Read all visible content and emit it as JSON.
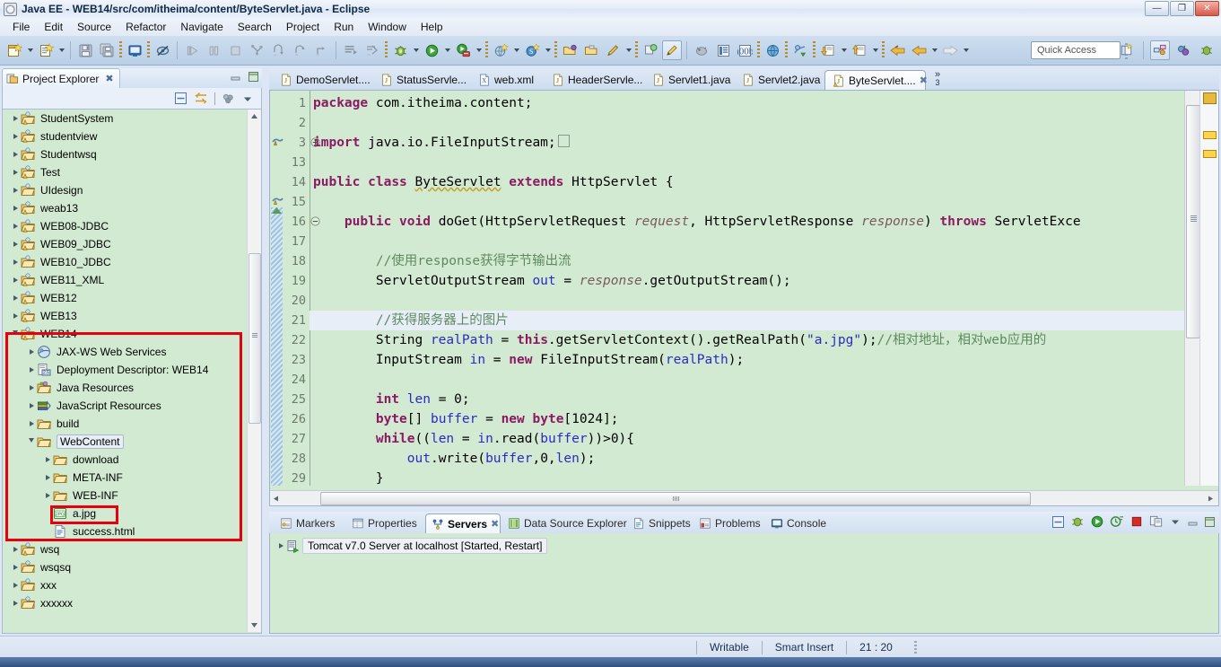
{
  "window": {
    "title": "Java EE - WEB14/src/com/itheima/content/ByteServlet.java - Eclipse",
    "app_icon": "eclipse-icon",
    "minimize_label": "—",
    "maximize_label": "❐",
    "close_label": "✕"
  },
  "menu": {
    "items": [
      "File",
      "Edit",
      "Source",
      "Refactor",
      "Navigate",
      "Search",
      "Project",
      "Run",
      "Window",
      "Help"
    ]
  },
  "toolbar": {
    "quick_access_placeholder": "Quick Access",
    "buttons": [
      {
        "name": "new-wizard-icon",
        "label": ""
      },
      {
        "name": "new-dropdown-arrow",
        "label": ""
      },
      {
        "name": "new-jsp-icon",
        "label": ""
      },
      {
        "name": "new-jsp-dropdown-arrow",
        "label": ""
      },
      {
        "name": "save-icon",
        "label": ""
      },
      {
        "name": "save-all-icon",
        "label": ""
      },
      {
        "name": "open-console-icon",
        "label": ""
      },
      {
        "name": "hide-icon",
        "label": ""
      },
      {
        "name": "resume-icon",
        "label": ""
      },
      {
        "name": "suspend-icon",
        "label": ""
      },
      {
        "name": "terminate-icon",
        "label": ""
      },
      {
        "name": "step-into-icon",
        "label": ""
      },
      {
        "name": "step-over-icon",
        "label": ""
      },
      {
        "name": "step-return-icon",
        "label": ""
      },
      {
        "name": "skip-breakpoints-icon",
        "label": ""
      },
      {
        "name": "debug-icon",
        "label": ""
      },
      {
        "name": "debug-dropdown-arrow",
        "label": ""
      },
      {
        "name": "run-icon",
        "label": ""
      },
      {
        "name": "run-dropdown-arrow",
        "label": ""
      },
      {
        "name": "run-on-server-icon",
        "label": ""
      },
      {
        "name": "run-on-server-dropdown-arrow",
        "label": ""
      },
      {
        "name": "new-web-project-icon",
        "label": ""
      },
      {
        "name": "new-web-dropdown-arrow",
        "label": ""
      },
      {
        "name": "new-spring-icon",
        "label": ""
      },
      {
        "name": "new-spring-dropdown-arrow",
        "label": ""
      },
      {
        "name": "open-type-icon",
        "label": ""
      },
      {
        "name": "open-task-icon",
        "label": ""
      },
      {
        "name": "edit-icon",
        "label": ""
      },
      {
        "name": "edit-dropdown-arrow",
        "label": ""
      },
      {
        "name": "search-icon",
        "label": ""
      },
      {
        "name": "annotation-icon",
        "label": ""
      },
      {
        "name": "toggle-mark-occurrences-icon",
        "label": ""
      },
      {
        "name": "outline-icon",
        "label": ""
      },
      {
        "name": "pilcrow-icon",
        "label": ""
      },
      {
        "name": "open-browser-icon",
        "label": ""
      },
      {
        "name": "open-perspective-icon",
        "label": ""
      },
      {
        "name": "previous-annotation-icon",
        "label": ""
      },
      {
        "name": "previous-dropdown-arrow",
        "label": ""
      },
      {
        "name": "next-annotation-icon",
        "label": ""
      },
      {
        "name": "next-dropdown-arrow",
        "label": ""
      },
      {
        "name": "back-icon",
        "label": ""
      },
      {
        "name": "forward-icon",
        "label": ""
      },
      {
        "name": "forward-dropdown-arrow",
        "label": ""
      }
    ],
    "perspective_buttons": [
      {
        "name": "open-perspective-button"
      },
      {
        "name": "perspective-java-ee-button"
      },
      {
        "name": "perspective-java-button"
      },
      {
        "name": "perspective-debug-button"
      }
    ]
  },
  "project_explorer": {
    "tab_label": "Project Explorer",
    "tab_icon": "project-explorer-icon",
    "close_icon": "close-icon",
    "minimize_icon": "minimize-icon",
    "maximize_icon": "maximize-icon",
    "toolbar": [
      {
        "name": "collapse-all-icon"
      },
      {
        "name": "link-with-editor-icon"
      },
      {
        "name": "view-menu-dots-icon"
      },
      {
        "name": "view-menu-icon"
      }
    ],
    "tree": [
      {
        "label": "StudentSystem",
        "depth": 0,
        "icon": "java-web-project-icon",
        "arrow": "closed",
        "warn": true
      },
      {
        "label": "studentview",
        "depth": 0,
        "icon": "java-web-project-icon",
        "arrow": "closed",
        "warn": true
      },
      {
        "label": "Studentwsq",
        "depth": 0,
        "icon": "java-web-project-icon",
        "arrow": "closed",
        "warn": true
      },
      {
        "label": "Test",
        "depth": 0,
        "icon": "java-web-project-icon",
        "arrow": "closed",
        "warn": true
      },
      {
        "label": "UIdesign",
        "depth": 0,
        "icon": "project-folder-icon",
        "arrow": "closed",
        "warn": false
      },
      {
        "label": "weab13",
        "depth": 0,
        "icon": "java-web-project-icon",
        "arrow": "closed",
        "warn": true
      },
      {
        "label": "WEB08-JDBC",
        "depth": 0,
        "icon": "java-web-project-icon",
        "arrow": "closed",
        "warn": true
      },
      {
        "label": "WEB09_JDBC",
        "depth": 0,
        "icon": "java-web-project-icon",
        "arrow": "closed",
        "warn": true
      },
      {
        "label": "WEB10_JDBC",
        "depth": 0,
        "icon": "project-folder-icon",
        "arrow": "closed",
        "warn": false
      },
      {
        "label": "WEB11_XML",
        "depth": 0,
        "icon": "java-web-project-icon",
        "arrow": "closed",
        "warn": true
      },
      {
        "label": "WEB12",
        "depth": 0,
        "icon": "java-web-project-icon",
        "arrow": "closed",
        "warn": true
      },
      {
        "label": "WEB13",
        "depth": 0,
        "icon": "java-web-project-icon",
        "arrow": "closed",
        "warn": true
      },
      {
        "label": "WEB14",
        "depth": 0,
        "icon": "java-web-project-icon",
        "arrow": "open",
        "warn": true
      },
      {
        "label": "JAX-WS Web Services",
        "depth": 1,
        "icon": "jax-ws-icon",
        "arrow": "closed",
        "warn": false
      },
      {
        "label": "Deployment Descriptor: WEB14",
        "depth": 1,
        "icon": "deployment-descriptor-icon",
        "arrow": "closed",
        "warn": false
      },
      {
        "label": "Java Resources",
        "depth": 1,
        "icon": "java-resources-icon",
        "arrow": "closed",
        "warn": false
      },
      {
        "label": "JavaScript Resources",
        "depth": 1,
        "icon": "javascript-resources-icon",
        "arrow": "closed",
        "warn": false
      },
      {
        "label": "build",
        "depth": 1,
        "icon": "folder-icon",
        "arrow": "closed",
        "warn": false
      },
      {
        "label": "WebContent",
        "depth": 1,
        "icon": "folder-icon",
        "arrow": "open",
        "warn": false,
        "selected": true
      },
      {
        "label": "download",
        "depth": 2,
        "icon": "folder-icon",
        "arrow": "closed",
        "warn": false
      },
      {
        "label": "META-INF",
        "depth": 2,
        "icon": "folder-icon",
        "arrow": "closed",
        "warn": false
      },
      {
        "label": "WEB-INF",
        "depth": 2,
        "icon": "folder-icon",
        "arrow": "closed",
        "warn": false
      },
      {
        "label": "a.jpg",
        "depth": 2,
        "icon": "jpg-file-icon",
        "arrow": "none",
        "warn": false,
        "highlighted": true
      },
      {
        "label": "success.html",
        "depth": 2,
        "icon": "html-file-icon",
        "arrow": "none",
        "warn": false
      },
      {
        "label": "wsq",
        "depth": 0,
        "icon": "java-web-project-icon",
        "arrow": "closed",
        "warn": true
      },
      {
        "label": "wsqsq",
        "depth": 0,
        "icon": "project-folder-icon",
        "arrow": "closed",
        "warn": false
      },
      {
        "label": "xxx",
        "depth": 0,
        "icon": "project-folder-icon",
        "arrow": "closed",
        "warn": false
      },
      {
        "label": "xxxxxx",
        "depth": 0,
        "icon": "project-folder-icon",
        "arrow": "closed",
        "warn": false
      }
    ]
  },
  "editor": {
    "tabs": [
      {
        "label": "DemoServlet....",
        "icon": "java-file-icon",
        "active": false,
        "closable": false
      },
      {
        "label": "StatusServle...",
        "icon": "java-file-icon",
        "active": false,
        "closable": false
      },
      {
        "label": "web.xml",
        "icon": "xml-file-icon",
        "active": false,
        "closable": false
      },
      {
        "label": "HeaderServle...",
        "icon": "java-file-icon",
        "active": false,
        "closable": false
      },
      {
        "label": "Servlet1.java",
        "icon": "java-file-icon",
        "active": false,
        "closable": false
      },
      {
        "label": "Servlet2.java",
        "icon": "java-file-icon",
        "active": false,
        "closable": false
      },
      {
        "label": "ByteServlet....",
        "icon": "java-file-warning-icon",
        "active": true,
        "closable": true,
        "close_icon": "close-icon"
      }
    ],
    "overflow_indicator": "»",
    "overflow_count": "3",
    "current_line": 21,
    "lines": [
      {
        "num": "1",
        "tokens": [
          {
            "t": "package",
            "c": "kw"
          },
          {
            "t": " com.itheima.content;",
            "c": ""
          }
        ]
      },
      {
        "num": "2",
        "tokens": []
      },
      {
        "num": "3",
        "fold": "plus",
        "marker": "warn",
        "tokens": [
          {
            "t": "import",
            "c": "kw"
          },
          {
            "t": " java.io.FileInputStream;",
            "c": ""
          },
          {
            "t": "⎕",
            "c": "fold-box"
          }
        ]
      },
      {
        "num": "13",
        "tokens": []
      },
      {
        "num": "14",
        "marker": "warn",
        "tokens": [
          {
            "t": "public",
            "c": "kw"
          },
          {
            "t": " ",
            "c": ""
          },
          {
            "t": "class",
            "c": "kw"
          },
          {
            "t": " ",
            "c": ""
          },
          {
            "t": "ByteServlet",
            "c": "cls-u"
          },
          {
            "t": " ",
            "c": ""
          },
          {
            "t": "extends",
            "c": "kw"
          },
          {
            "t": " HttpServlet {",
            "c": ""
          }
        ]
      },
      {
        "num": "15",
        "tokens": []
      },
      {
        "num": "16",
        "fold": "minus",
        "tokens": [
          {
            "t": "    ",
            "c": ""
          },
          {
            "t": "public",
            "c": "kw"
          },
          {
            "t": " ",
            "c": ""
          },
          {
            "t": "void",
            "c": "kw"
          },
          {
            "t": " doGet(HttpServletRequest ",
            "c": ""
          },
          {
            "t": "request",
            "c": "par"
          },
          {
            "t": ", HttpServletResponse ",
            "c": ""
          },
          {
            "t": "response",
            "c": "par"
          },
          {
            "t": ") ",
            "c": ""
          },
          {
            "t": "throws",
            "c": "kw"
          },
          {
            "t": " ServletExce",
            "c": ""
          }
        ]
      },
      {
        "num": "17",
        "tokens": []
      },
      {
        "num": "18",
        "tokens": [
          {
            "t": "        //使用response获得字节输出流",
            "c": "cmt"
          }
        ]
      },
      {
        "num": "19",
        "tokens": [
          {
            "t": "        ServletOutputStream ",
            "c": ""
          },
          {
            "t": "out",
            "c": "fld"
          },
          {
            "t": " = ",
            "c": ""
          },
          {
            "t": "response",
            "c": "par"
          },
          {
            "t": ".getOutputStream();",
            "c": ""
          }
        ]
      },
      {
        "num": "20",
        "tokens": []
      },
      {
        "num": "21",
        "tokens": [
          {
            "t": "        //获得服务器上的图片",
            "c": "cmt"
          }
        ]
      },
      {
        "num": "22",
        "tokens": [
          {
            "t": "        String ",
            "c": ""
          },
          {
            "t": "realPath",
            "c": "fld"
          },
          {
            "t": " = ",
            "c": ""
          },
          {
            "t": "this",
            "c": "kw"
          },
          {
            "t": ".getServletContext().getRealPath(",
            "c": ""
          },
          {
            "t": "\"a.jpg\"",
            "c": "str"
          },
          {
            "t": ");",
            "c": ""
          },
          {
            "t": "//相对地址，相对web应用的",
            "c": "cmt"
          }
        ]
      },
      {
        "num": "23",
        "tokens": [
          {
            "t": "        InputStream ",
            "c": ""
          },
          {
            "t": "in",
            "c": "fld"
          },
          {
            "t": " = ",
            "c": ""
          },
          {
            "t": "new",
            "c": "kw"
          },
          {
            "t": " FileInputStream(",
            "c": ""
          },
          {
            "t": "realPath",
            "c": "fld"
          },
          {
            "t": ");",
            "c": ""
          }
        ]
      },
      {
        "num": "24",
        "tokens": []
      },
      {
        "num": "25",
        "tokens": [
          {
            "t": "        ",
            "c": ""
          },
          {
            "t": "int",
            "c": "kw"
          },
          {
            "t": " ",
            "c": ""
          },
          {
            "t": "len",
            "c": "fld"
          },
          {
            "t": " = 0;",
            "c": ""
          }
        ]
      },
      {
        "num": "26",
        "tokens": [
          {
            "t": "        ",
            "c": ""
          },
          {
            "t": "byte",
            "c": "kw"
          },
          {
            "t": "[] ",
            "c": ""
          },
          {
            "t": "buffer",
            "c": "fld"
          },
          {
            "t": " = ",
            "c": ""
          },
          {
            "t": "new",
            "c": "kw"
          },
          {
            "t": " ",
            "c": ""
          },
          {
            "t": "byte",
            "c": "kw"
          },
          {
            "t": "[1024];",
            "c": ""
          }
        ]
      },
      {
        "num": "27",
        "tokens": [
          {
            "t": "        ",
            "c": ""
          },
          {
            "t": "while",
            "c": "kw"
          },
          {
            "t": "((",
            "c": ""
          },
          {
            "t": "len",
            "c": "fld"
          },
          {
            "t": " = ",
            "c": ""
          },
          {
            "t": "in",
            "c": "fld"
          },
          {
            "t": ".read(",
            "c": ""
          },
          {
            "t": "buffer",
            "c": "fld"
          },
          {
            "t": "))>0){",
            "c": ""
          }
        ]
      },
      {
        "num": "28",
        "tokens": [
          {
            "t": "            ",
            "c": ""
          },
          {
            "t": "out",
            "c": "fld"
          },
          {
            "t": ".write(",
            "c": ""
          },
          {
            "t": "buffer",
            "c": "fld"
          },
          {
            "t": ",0,",
            "c": ""
          },
          {
            "t": "len",
            "c": "fld"
          },
          {
            "t": ");",
            "c": ""
          }
        ]
      },
      {
        "num": "29",
        "tokens": [
          {
            "t": "        }",
            "c": ""
          }
        ]
      }
    ]
  },
  "bottom_panel": {
    "tabs": [
      {
        "label": "Markers",
        "icon": "markers-icon",
        "active": false
      },
      {
        "label": "Properties",
        "icon": "properties-icon",
        "active": false
      },
      {
        "label": "Servers",
        "icon": "servers-icon",
        "active": true,
        "close_icon": "close-icon"
      },
      {
        "label": "Data Source Explorer",
        "icon": "data-source-explorer-icon",
        "active": false
      },
      {
        "label": "Snippets",
        "icon": "snippets-icon",
        "active": false
      },
      {
        "label": "Problems",
        "icon": "problems-icon",
        "active": false
      },
      {
        "label": "Console",
        "icon": "console-icon",
        "active": false
      }
    ],
    "toolbar": [
      {
        "name": "collapse-all-icon"
      },
      {
        "name": "debug-server-icon"
      },
      {
        "name": "start-server-icon"
      },
      {
        "name": "profile-server-icon"
      },
      {
        "name": "stop-server-icon"
      },
      {
        "name": "publish-server-icon"
      },
      {
        "name": "view-menu-icon"
      },
      {
        "name": "minimize-icon"
      },
      {
        "name": "maximize-icon"
      }
    ],
    "servers": [
      {
        "label": "Tomcat v7.0 Server at localhost  [Started, Restart]",
        "icon": "tomcat-server-icon",
        "arrow": "closed",
        "selected": true
      }
    ]
  },
  "status_bar": {
    "writable": "Writable",
    "insert_mode": "Smart Insert",
    "cursor_position": "21 : 20"
  },
  "colors": {
    "tree_background": "#d2e9d2",
    "editor_background": "#d2e9d2",
    "annotation_red": "#e8000d",
    "keyword": "#8b1a63",
    "comment": "#5f8a5f",
    "string": "#2a2ac6",
    "field": "#2a2ac6",
    "parameter": "#7b5a5a"
  }
}
